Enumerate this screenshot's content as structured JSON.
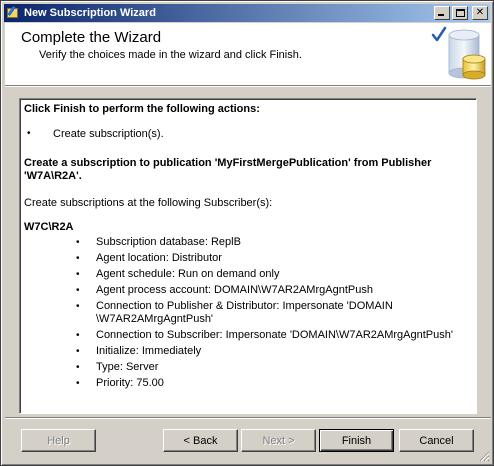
{
  "window": {
    "title": "New Subscription Wizard"
  },
  "title_buttons": {
    "minimize_icon": "minimize-icon",
    "maximize_icon": "maximize-icon",
    "close_icon": "close-icon"
  },
  "header": {
    "title": "Complete the Wizard",
    "subtitle": "Verify the choices made in the wizard and click Finish.",
    "art_icon": "database-checkmark-icon"
  },
  "report": {
    "heading": "Click Finish to perform the following actions:",
    "actions": [
      "Create subscription(s)."
    ],
    "publication_line": "Create a subscription to publication 'MyFirstMergePublication' from Publisher 'W7A\\R2A'.",
    "subscribers_intro": "Create subscriptions at the following Subscriber(s):",
    "subscriber": "W7C\\R2A",
    "details": [
      "Subscription database: ReplB",
      "Agent location: Distributor",
      "Agent schedule: Run on demand only",
      "Agent process account: DOMAIN\\W7AR2AMrgAgntPush",
      "Connection to Publisher & Distributor: Impersonate 'DOMAIN \\W7AR2AMrgAgntPush'",
      "Connection to Subscriber: Impersonate 'DOMAIN\\W7AR2AMrgAgntPush'",
      "Initialize: Immediately",
      "Type: Server",
      "Priority: 75.00"
    ],
    "bullet_char": "•"
  },
  "buttons": {
    "help": "Help",
    "back": "< Back",
    "next": "Next >",
    "finish": "Finish",
    "cancel": "Cancel"
  },
  "colors": {
    "titlebar_start": "#0a246a",
    "titlebar_end": "#a6caf0",
    "dialog_face": "#d4d0c8"
  }
}
